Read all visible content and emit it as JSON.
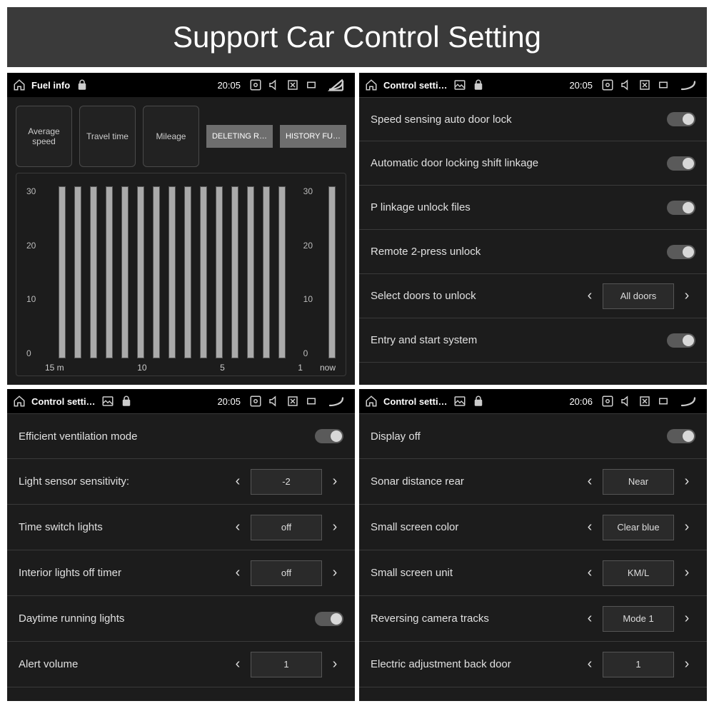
{
  "banner": "Support Car Control Setting",
  "panels": {
    "fuel": {
      "title": "Fuel info",
      "clock": "20:05",
      "cards": [
        "Average speed",
        "Travel time",
        "Mileage"
      ],
      "buttons": [
        "DELETING R…",
        "HISTORY FU…"
      ],
      "y_ticks": [
        "30",
        "20",
        "10",
        "0"
      ],
      "x_ticks": [
        "15 m",
        "10",
        "5",
        "1"
      ],
      "now_label": "now"
    },
    "p2": {
      "title": "Control setti…",
      "clock": "20:05",
      "rows": [
        {
          "label": "Speed sensing auto door lock",
          "type": "toggle"
        },
        {
          "label": "Automatic door locking shift linkage",
          "type": "toggle"
        },
        {
          "label": "P linkage unlock files",
          "type": "toggle"
        },
        {
          "label": "Remote 2-press unlock",
          "type": "toggle"
        },
        {
          "label": "Select doors to unlock",
          "type": "stepper",
          "value": "All doors"
        },
        {
          "label": "Entry and start system",
          "type": "toggle"
        }
      ]
    },
    "p3": {
      "title": "Control setti…",
      "clock": "20:05",
      "rows": [
        {
          "label": "Efficient ventilation mode",
          "type": "toggle"
        },
        {
          "label": "Light sensor sensitivity:",
          "type": "stepper",
          "value": "-2"
        },
        {
          "label": "Time switch lights",
          "type": "stepper",
          "value": "off"
        },
        {
          "label": "Interior lights off timer",
          "type": "stepper",
          "value": "off"
        },
        {
          "label": "Daytime running lights",
          "type": "toggle"
        },
        {
          "label": "Alert volume",
          "type": "stepper",
          "value": "1"
        }
      ]
    },
    "p4": {
      "title": "Control setti…",
      "clock": "20:06",
      "rows": [
        {
          "label": "Display off",
          "type": "toggle"
        },
        {
          "label": "Sonar distance rear",
          "type": "stepper",
          "value": "Near"
        },
        {
          "label": "Small screen color",
          "type": "stepper",
          "value": "Clear blue"
        },
        {
          "label": "Small screen unit",
          "type": "stepper",
          "value": "KM/L"
        },
        {
          "label": "Reversing camera tracks",
          "type": "stepper",
          "value": "Mode 1"
        },
        {
          "label": "Electric adjustment back door",
          "type": "stepper",
          "value": "1"
        }
      ]
    }
  }
}
